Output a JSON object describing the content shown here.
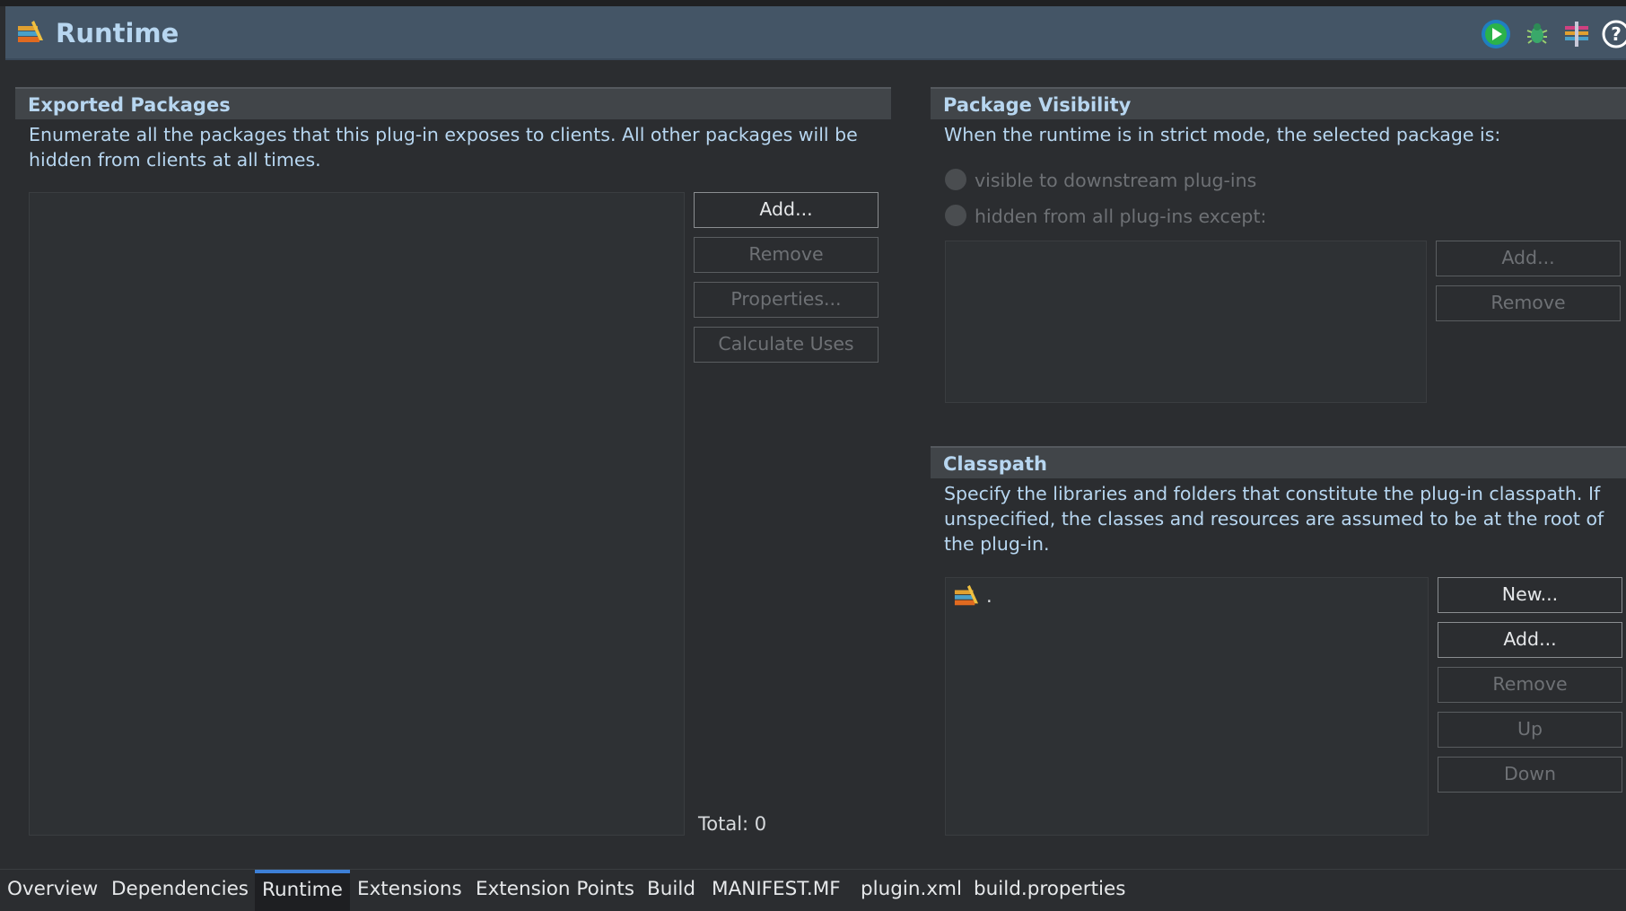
{
  "header": {
    "title": "Runtime"
  },
  "icons": {
    "logo": "plugin-icon",
    "run": "run-icon",
    "debug": "debug-icon",
    "profile": "profile-icon",
    "help": "help-icon"
  },
  "exported_packages": {
    "title": "Exported Packages",
    "description": "Enumerate all the packages that this plug-in exposes to clients.  All other packages will be hidden from clients at all times.",
    "buttons": {
      "add": "Add...",
      "remove": "Remove",
      "properties": "Properties...",
      "calculate_uses": "Calculate Uses"
    },
    "total": "Total: 0"
  },
  "package_visibility": {
    "title": "Package Visibility",
    "description": "When the runtime is in strict mode, the selected package is:",
    "options": [
      "visible to downstream plug-ins",
      "hidden from all plug-ins except:"
    ],
    "buttons": {
      "add": "Add...",
      "remove": "Remove"
    }
  },
  "classpath": {
    "title": "Classpath",
    "description": "Specify the libraries and folders that constitute the plug-in classpath.  If unspecified, the classes and resources are assumed to be at the root of the plug-in.",
    "items": [
      "."
    ],
    "buttons": {
      "new": "New...",
      "add": "Add...",
      "remove": "Remove",
      "up": "Up",
      "down": "Down"
    }
  },
  "tabs": [
    "Overview",
    "Dependencies",
    "Runtime",
    "Extensions",
    "Extension Points",
    "Build",
    "MANIFEST.MF",
    "plugin.xml",
    "build.properties"
  ],
  "active_tab": "Runtime",
  "colors": {
    "header_bg": "#445566",
    "title": "#b7d6f0",
    "tab_accent": "#3d7fd6"
  }
}
